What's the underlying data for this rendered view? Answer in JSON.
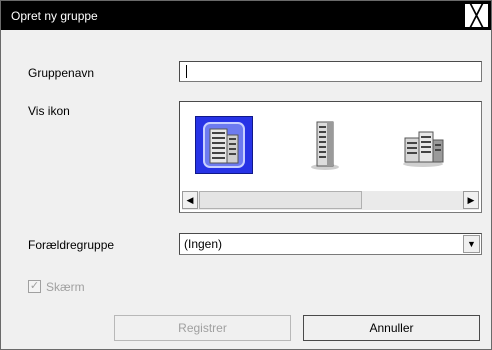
{
  "dialog": {
    "title": "Opret ny gruppe",
    "close_glyph": "╳"
  },
  "fields": {
    "name_label": "Gruppenavn",
    "name_value": "",
    "icon_label": "Vis ikon",
    "icons": [
      {
        "name": "building-tall-icon",
        "selected": true
      },
      {
        "name": "skyscraper-icon",
        "selected": false
      },
      {
        "name": "office-building-icon",
        "selected": false
      }
    ],
    "parent_label": "Forældregruppe",
    "parent_value": "(Ingen)",
    "screen_checkbox_label": "Skærm",
    "screen_checked": true
  },
  "buttons": {
    "register": "Registrer",
    "cancel": "Annuller"
  },
  "colors": {
    "titlebar": "#000000",
    "selection": "#2733e6"
  }
}
